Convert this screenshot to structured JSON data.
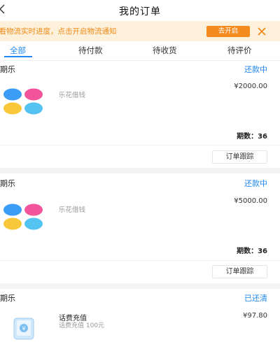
{
  "header": {
    "title": "我的订单"
  },
  "notice": {
    "text": "查看物流实时进度，点击开启物流通知",
    "button_label": "去开启"
  },
  "tabs": [
    {
      "label": "全部",
      "active": true
    },
    {
      "label": "待付款",
      "active": false
    },
    {
      "label": "待收货",
      "active": false
    },
    {
      "label": "待评价",
      "active": false
    }
  ],
  "orders": [
    {
      "type": "分期乐",
      "status": "还款中",
      "product": "乐花借钱",
      "price": "¥2000.00",
      "periods": "期数：36",
      "action": "订单跟踪"
    },
    {
      "type": "分期乐",
      "status": "还款中",
      "product": "乐花借钱",
      "price": "¥5000.00",
      "periods": "期数：36",
      "action": "订单跟踪"
    },
    {
      "type": "分期乐",
      "status": "已还清",
      "product": "话费充值",
      "product_sub": "话费充值 100元",
      "price": "¥97.80"
    }
  ],
  "colors": {
    "accent": "#1f87ef",
    "notice_bg": "#fdf1dc",
    "notice_text": "#f08a16",
    "petal_pink": "#f2559b",
    "petal_blue": "#3b9df5",
    "petal_yellow": "#f8c73a",
    "petal_cyan": "#54c3f1"
  }
}
